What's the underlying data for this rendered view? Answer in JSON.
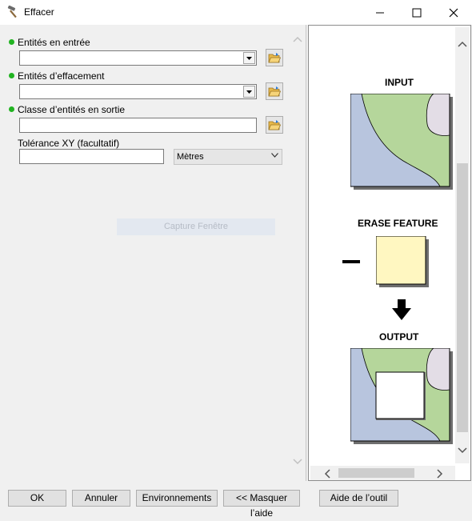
{
  "window": {
    "title": "Effacer",
    "app_icon": "hammer-icon",
    "controls": [
      "minimize-icon",
      "maximize-icon",
      "close-icon"
    ]
  },
  "form": {
    "input_features": {
      "label": "Entités en entrée",
      "value": "",
      "required_indicator_color": "#21b321"
    },
    "erase_features": {
      "label": "Entités d’effacement",
      "value": "",
      "required_indicator_color": "#21b321"
    },
    "output_feature_class": {
      "label": "Classe d’entités en sortie",
      "value": "",
      "required_indicator_color": "#21b321"
    },
    "xy_tolerance": {
      "label": "Tolérance XY (facultatif)",
      "value": "",
      "units": "Mètres"
    },
    "capture_label": "Capture Fenêtre"
  },
  "help_panel": {
    "input_label": "INPUT",
    "erase_label": "ERASE FEATURE",
    "output_label": "OUTPUT",
    "colors": {
      "land_green": "#b5d69b",
      "water_blue": "#b8c5de",
      "pink": "#e3dde6",
      "erase_yellow": "#fff7c1"
    }
  },
  "buttons": {
    "ok": "OK",
    "cancel": "Annuler",
    "environments": "Environnements",
    "hide_help": "<< Masquer l’aide",
    "tool_help": "Aide de l’outil"
  }
}
